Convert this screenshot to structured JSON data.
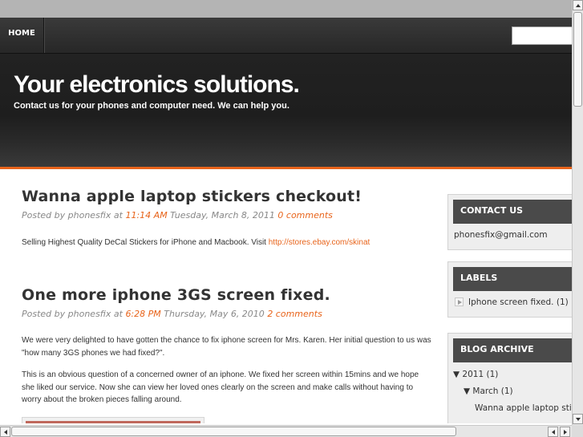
{
  "nav": {
    "home_label": "HOME",
    "search_placeholder": ""
  },
  "header": {
    "title": "Your electronics solutions.",
    "description": "Contact us for your phones and computer need. We can help you."
  },
  "posts": [
    {
      "title": "Wanna apple laptop stickers checkout!",
      "meta_prefix": "Posted by phonesfix at ",
      "time": "11:14 AM",
      "date": " Tuesday, March 8, 2011 ",
      "comments": "0 comments",
      "body": "Selling Highest Quality DeCal Stickers for iPhone and Macbook. Visit ",
      "body_link": "http://stores.ebay.com/skinat"
    },
    {
      "title": "One more iphone 3GS screen fixed.",
      "meta_prefix": "Posted by phonesfix at ",
      "time": "6:28 PM",
      "date": " Thursday, May 6, 2010 ",
      "comments": "2 comments",
      "paragraph1": "We were very delighted to have gotten the chance to fix iphone screen for Mrs. Karen. Her initial question to us was \"how many 3GS phones we had fixed?\".",
      "paragraph2": "This is an obvious question of a concerned owner of an iphone. We fixed her screen within 15mins and we hope she liked our service. Now she can view her loved ones clearly on the screen and make calls without having to worry about the broken pieces falling around."
    }
  ],
  "sidebar": {
    "contact": {
      "heading": "CONTACT US",
      "email": "phonesfix@gmail.com"
    },
    "labels": {
      "heading": "LABELS",
      "items": [
        {
          "label": "Iphone screen fixed.",
          "count": "(1)"
        }
      ]
    },
    "archive": {
      "heading": "BLOG ARCHIVE",
      "year_toggle": "▼",
      "year": "2011",
      "year_count": "(1)",
      "month_toggle": "▼",
      "month": "March",
      "month_count": "(1)",
      "post": "Wanna apple laptop stickers checkout!"
    }
  },
  "colors": {
    "accent": "#e8641b",
    "header_bg": "#222222",
    "widget_head": "#4a4a4a"
  }
}
